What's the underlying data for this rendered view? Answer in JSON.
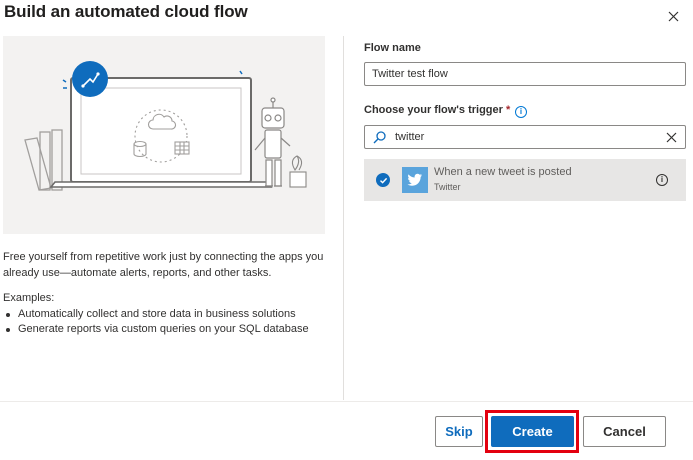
{
  "dialog": {
    "title": "Build an automated cloud flow",
    "close_icon": "close-icon"
  },
  "left_panel": {
    "description": "Free yourself from repetitive work just by connecting the apps you already use—automate alerts, reports, and other tasks.",
    "examples_title": "Examples:",
    "examples": [
      "Automatically collect and store data in business solutions",
      "Generate reports via custom queries on your SQL database"
    ]
  },
  "form": {
    "flow_name_label": "Flow name",
    "flow_name_value": "Twitter test flow",
    "trigger_label": "Choose your flow's trigger",
    "required_marker": "*",
    "search_value": "twitter",
    "triggers": [
      {
        "name": "When a new tweet is posted",
        "connector": "Twitter",
        "selected": true,
        "icon": "twitter-icon"
      }
    ]
  },
  "footer": {
    "skip_label": "Skip",
    "create_label": "Create",
    "cancel_label": "Cancel"
  },
  "colors": {
    "primary": "#0f6cbd",
    "highlight": "#e3000f",
    "twitter_tile": "#5aa4dc"
  }
}
